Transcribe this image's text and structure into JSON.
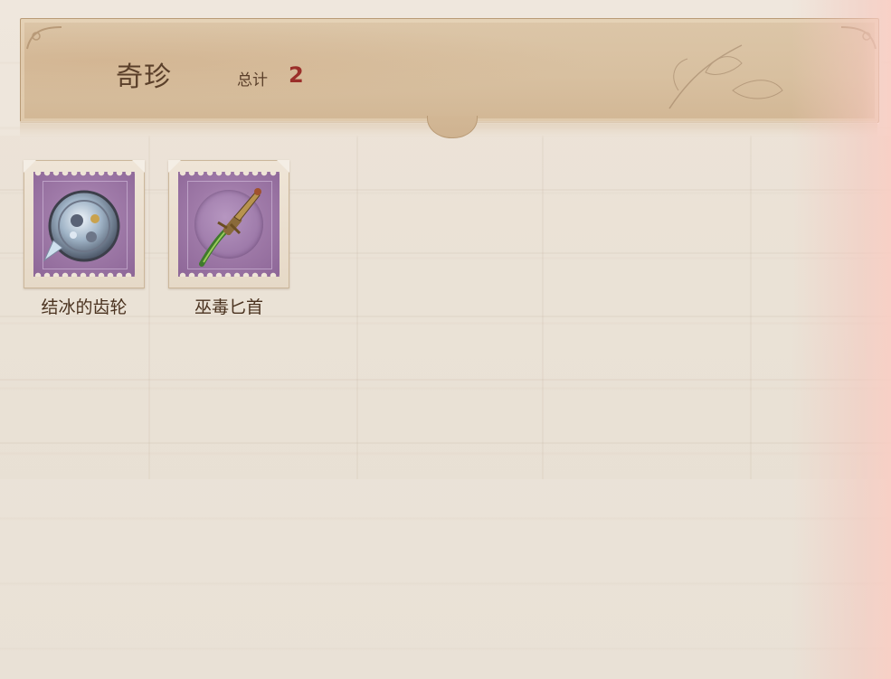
{
  "header": {
    "title": "奇珍",
    "total_label": "总计",
    "total_value": "2"
  },
  "items": [
    {
      "name": "结冰的齿轮",
      "icon": "frozen-gear-icon"
    },
    {
      "name": "巫毒匕首",
      "icon": "voodoo-dagger-icon"
    }
  ],
  "colors": {
    "title": "#5a3f2a",
    "total_value": "#9b2f2a",
    "stamp_purple": "#9f7aa8",
    "background": "#ebe3d8"
  }
}
